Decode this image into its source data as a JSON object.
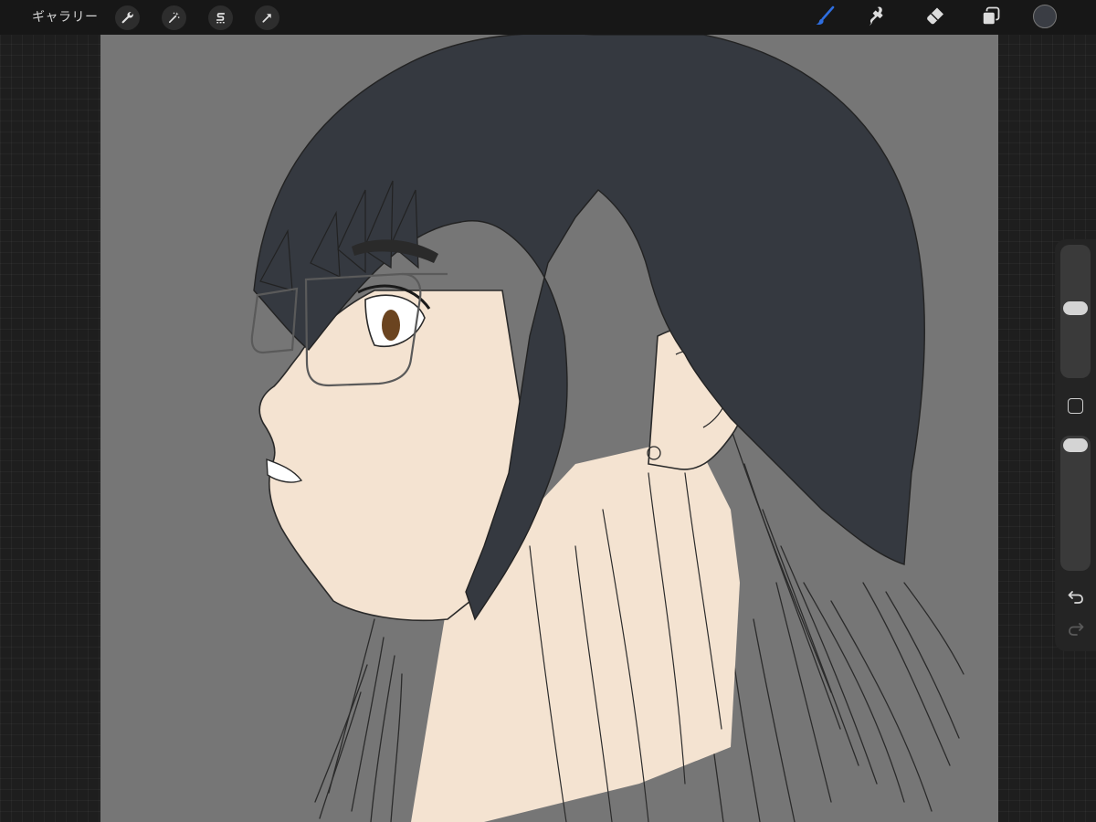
{
  "app": {
    "gallery_label": "ギャラリー"
  },
  "toolbar_left": {
    "icons": [
      "wrench-icon",
      "magic-wand-icon",
      "selection-s-icon",
      "transform-arrow-icon"
    ]
  },
  "toolbar_right": {
    "icons": [
      "brush-icon",
      "smudge-icon",
      "eraser-icon",
      "layers-icon"
    ],
    "active_tool": "brush",
    "active_color": "#2e6ee0",
    "current_color": "#3a3d44"
  },
  "sidebar": {
    "brush_size_level": 0.45,
    "opacity_level": 0.96,
    "icons": [
      "modify-square-icon",
      "undo-icon",
      "redo-icon"
    ]
  },
  "colors": {
    "canvas_bg": "#767676",
    "hair": "#353940",
    "skin": "#f4e3d1",
    "line": "#2a2a2a"
  }
}
